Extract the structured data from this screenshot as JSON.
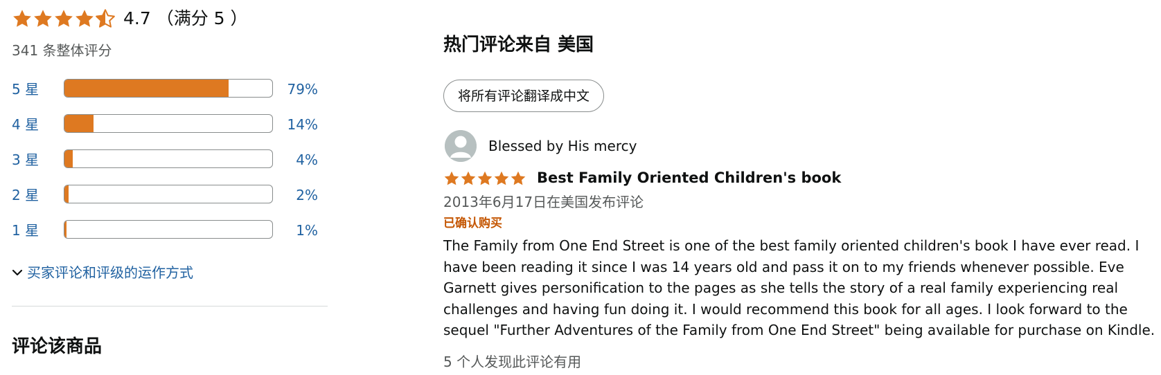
{
  "summary": {
    "average_rating": 4.7,
    "rating_text": "4.7 （满分 5 ）",
    "total_ratings": "341 条整体评分"
  },
  "histogram": [
    {
      "label": "5 星",
      "percent_text": "79%",
      "percent": 79
    },
    {
      "label": "4 星",
      "percent_text": "14%",
      "percent": 14
    },
    {
      "label": "3 星",
      "percent_text": "4%",
      "percent": 4
    },
    {
      "label": "2 星",
      "percent_text": "2%",
      "percent": 2
    },
    {
      "label": "1 星",
      "percent_text": "1%",
      "percent": 1
    }
  ],
  "how_ratings_work_link": "买家评论和评级的运作方式",
  "review_product_heading": "评论该商品",
  "top_reviews": {
    "heading": "热门评论来自 美国",
    "translate_button": "将所有评论翻译成中文",
    "review": {
      "reviewer": "Blessed by His mercy",
      "rating": 5,
      "title": "Best Family Oriented Children's book",
      "date": "2013年6月17日在美国发布评论",
      "verified": "已确认购买",
      "body": "The Family from One End Street is one of the best family oriented children's book I have ever read. I have been reading it since I was 14 years old and pass it on to my friends whenever possible. Eve Garnett gives personification to the pages as she tells the story of a real family experiencing real challenges and having fun doing it. I would recommend this book for all ages. I look forward to the sequel \"Further Adventures of the Family from One End Street\" being available for purchase on Kindle.",
      "helpful": "5 个人发现此评论有用"
    }
  },
  "colors": {
    "star": "#de7921",
    "link": "#2162a1",
    "verified": "#c45500",
    "bar_border": "#888c8c",
    "muted_text": "#565959"
  },
  "icons": {
    "star": "star-icon",
    "half_star": "half-star-icon",
    "chevron": "chevron-down-icon",
    "avatar": "default-avatar-icon"
  }
}
